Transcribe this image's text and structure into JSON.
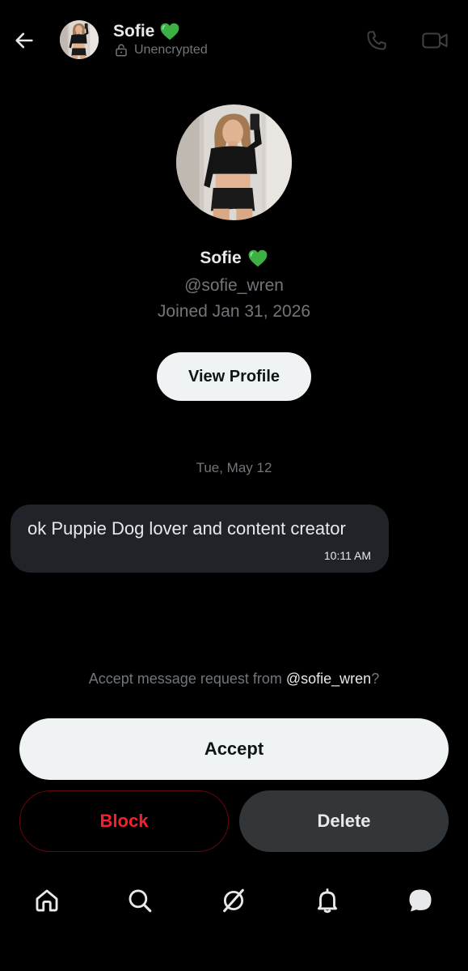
{
  "header": {
    "name": "Sofie",
    "encryption_status": "Unencrypted"
  },
  "profile": {
    "name": "Sofie",
    "handle": "@sofie_wren",
    "joined": "Joined Jan 31, 2026",
    "view_profile_label": "View Profile"
  },
  "conversation": {
    "date": "Tue, May 12",
    "messages": [
      {
        "text": "ok Puppie Dog lover and content creator",
        "time": "10:11 AM"
      }
    ]
  },
  "request": {
    "prompt_prefix": "Accept message request from ",
    "handle": "@sofie_wren",
    "prompt_suffix": "?",
    "accept_label": "Accept",
    "block_label": "Block",
    "delete_label": "Delete"
  },
  "nav": {
    "items": [
      "home-icon",
      "search-icon",
      "grok-icon",
      "notifications-icon",
      "messages-icon"
    ]
  },
  "colors": {
    "background": "#000000",
    "primary_text": "#e7e9ea",
    "secondary_text": "#71767b",
    "bubble": "#202327",
    "block_red": "#f4212e",
    "heart_green": "#3cb043"
  }
}
